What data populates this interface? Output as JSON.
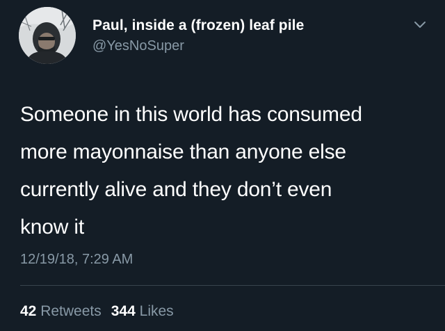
{
  "tweet": {
    "author": {
      "display_name": "Paul, inside a (frozen) leaf pile",
      "handle": "@YesNoSuper",
      "avatar_icon": "person-in-hood-photo"
    },
    "menu_icon": "chevron-down-icon",
    "text_lines": [
      "Someone in this world has consumed",
      "more mayonnaise than anyone else",
      "currently alive and they don’t even",
      "know it"
    ],
    "timestamp": "12/19/18, 7:29 AM",
    "stats": {
      "retweets_count": "42",
      "retweets_label": "Retweets",
      "likes_count": "344",
      "likes_label": "Likes"
    }
  },
  "colors": {
    "background": "#141d26",
    "primary_text": "#ffffff",
    "secondary_text": "#8899a6",
    "divider": "#38444d"
  }
}
